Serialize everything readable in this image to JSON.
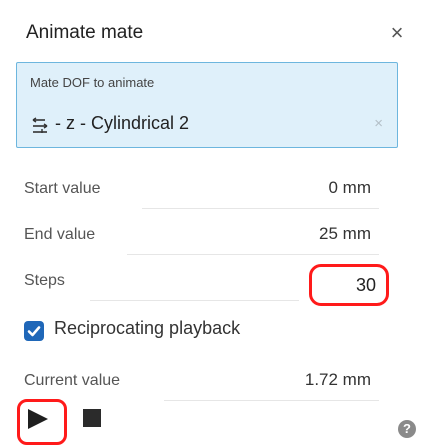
{
  "dialog": {
    "title": "Animate mate",
    "close_symbol": "×"
  },
  "dof": {
    "label": "Mate DOF to animate",
    "value": " - z - Cylindrical 2",
    "clear_symbol": "×",
    "icon": "mate-connector-icon",
    "border_color": "#6db6de",
    "background_color": "#dff0fa"
  },
  "fields": {
    "start": {
      "label": "Start value",
      "value": "0 mm"
    },
    "end": {
      "label": "End value",
      "value": "25 mm"
    },
    "steps": {
      "label": "Steps",
      "value": "30"
    },
    "current": {
      "label": "Current value",
      "value": "1.72 mm"
    }
  },
  "reciprocating": {
    "label": "Reciprocating playback",
    "checked": true,
    "checkbox_color": "#1f67b8"
  },
  "controls": {
    "play_icon": "play-icon",
    "stop_icon": "stop-icon",
    "help_symbol": "?"
  },
  "highlight_color": "#ff1a1a"
}
